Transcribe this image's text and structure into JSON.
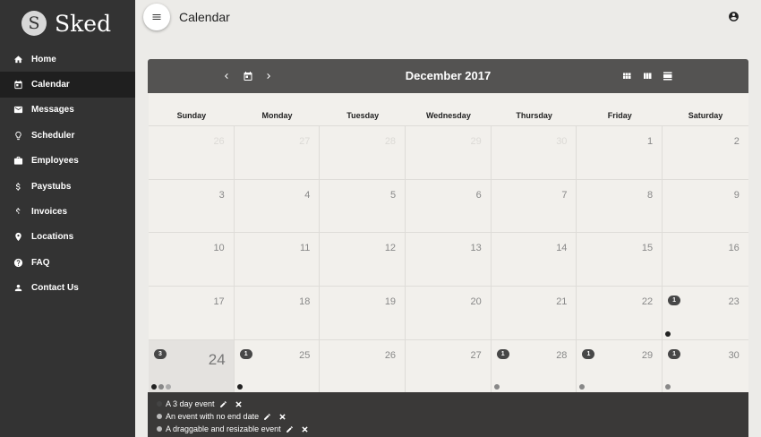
{
  "app": {
    "logo_letter": "S",
    "name": "Sked"
  },
  "sidebar": {
    "items": [
      {
        "label": "Home",
        "icon": "home-icon"
      },
      {
        "label": "Calendar",
        "icon": "calendar-icon",
        "active": true
      },
      {
        "label": "Messages",
        "icon": "mail-icon"
      },
      {
        "label": "Scheduler",
        "icon": "lightbulb-icon"
      },
      {
        "label": "Employees",
        "icon": "briefcase-icon"
      },
      {
        "label": "Paystubs",
        "icon": "dollar-icon"
      },
      {
        "label": "Invoices",
        "icon": "dollar-icon"
      },
      {
        "label": "Locations",
        "icon": "location-pin-icon"
      },
      {
        "label": "FAQ",
        "icon": "help-icon"
      },
      {
        "label": "Contact Us",
        "icon": "person-icon"
      }
    ]
  },
  "header": {
    "title": "Calendar",
    "menu_icon": "menu-icon",
    "account_icon": "account-circle-icon"
  },
  "calendar": {
    "title": "December 2017",
    "weekdays": [
      "Sunday",
      "Monday",
      "Tuesday",
      "Wednesday",
      "Thursday",
      "Friday",
      "Saturday"
    ],
    "weeks": [
      [
        {
          "day": "26",
          "other": true
        },
        {
          "day": "27",
          "other": true
        },
        {
          "day": "28",
          "other": true
        },
        {
          "day": "29",
          "other": true
        },
        {
          "day": "30",
          "other": true
        },
        {
          "day": "1"
        },
        {
          "day": "2"
        }
      ],
      [
        {
          "day": "3"
        },
        {
          "day": "4"
        },
        {
          "day": "5"
        },
        {
          "day": "6"
        },
        {
          "day": "7"
        },
        {
          "day": "8"
        },
        {
          "day": "9"
        }
      ],
      [
        {
          "day": "10"
        },
        {
          "day": "11"
        },
        {
          "day": "12"
        },
        {
          "day": "13"
        },
        {
          "day": "14"
        },
        {
          "day": "15"
        },
        {
          "day": "16"
        }
      ],
      [
        {
          "day": "17"
        },
        {
          "day": "18"
        },
        {
          "day": "19"
        },
        {
          "day": "20"
        },
        {
          "day": "21"
        },
        {
          "day": "22"
        },
        {
          "day": "23",
          "badge": "1",
          "dots": [
            "#222222"
          ]
        }
      ],
      [
        {
          "day": "24",
          "today": true,
          "badge": "3",
          "dots": [
            "#222222",
            "#888888",
            "#aaaaaa"
          ]
        },
        {
          "day": "25",
          "badge": "1",
          "dots": [
            "#222222"
          ]
        },
        {
          "day": "26"
        },
        {
          "day": "27"
        },
        {
          "day": "28",
          "badge": "1",
          "dots": [
            "#888888"
          ]
        },
        {
          "day": "29",
          "badge": "1",
          "dots": [
            "#888888"
          ]
        },
        {
          "day": "30",
          "badge": "1",
          "dots": [
            "#888888"
          ]
        }
      ]
    ]
  },
  "events": [
    {
      "title": "A 3 day event",
      "color": "#444444"
    },
    {
      "title": "An event with no end date",
      "color": "#bbbbbb"
    },
    {
      "title": "A draggable and resizable event",
      "color": "#bbbbbb"
    }
  ]
}
